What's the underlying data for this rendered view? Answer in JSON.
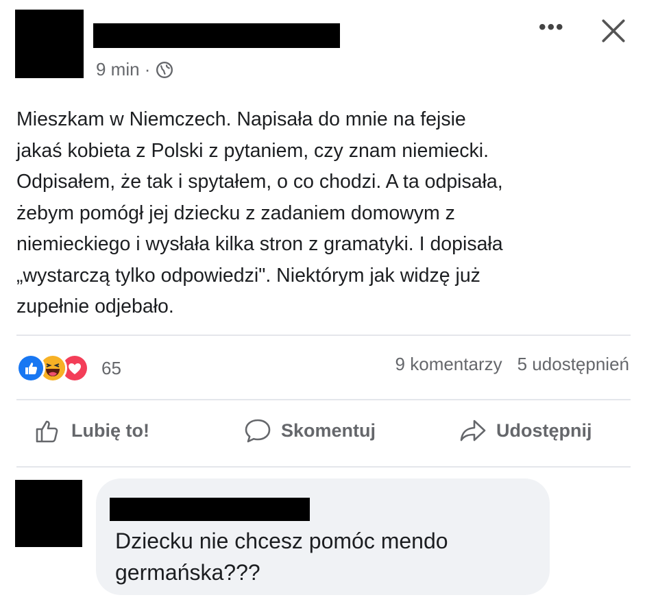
{
  "post": {
    "time": "9 min ·",
    "privacy_icon": "globe-icon",
    "body": "Mieszkam w Niemczech. Napisała do mnie na fejsie\njakaś kobieta z Polski z pytaniem, czy znam niemiecki.\nOdpisałem, że tak i spytałem, o co chodzi. A ta odpisała,\nżebym pomógł jej dziecku z zadaniem domowym z\nniemieckiego i wysłała kilka stron z gramatyki. I dopisała\n„wystarczą tylko odpowiedzi\". Niektórym jak widzę już\nzupełnie odjebało.",
    "reaction_icons": [
      "like-icon",
      "haha-icon",
      "love-icon"
    ],
    "reaction_count": "65",
    "comments_count": "9 komentarzy",
    "shares_count": "5 udostępnień"
  },
  "actions": {
    "like": "Lubię to!",
    "comment": "Skomentuj",
    "share": "Udostępnij"
  },
  "comment": {
    "text": "Dziecku nie chcesz pomóc mendo germańska???"
  },
  "colors": {
    "like_blue": "#1877f2",
    "love_red": "#f33e58",
    "haha_yellow": "#f7b125",
    "muted": "#65676b",
    "bubble": "#f0f2f5"
  }
}
